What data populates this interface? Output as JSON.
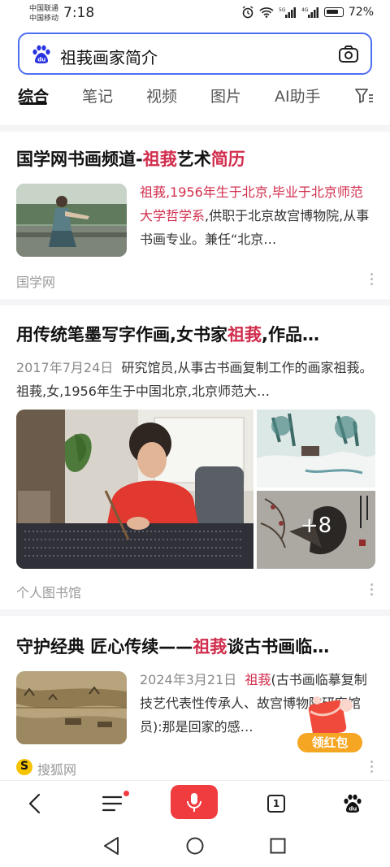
{
  "status": {
    "carrier1": "中国联通",
    "carrier2": "中国移动",
    "time": "7:18",
    "battery": "72%"
  },
  "search": {
    "query": "祖莪画家简介"
  },
  "tabs": [
    "综合",
    "笔记",
    "视频",
    "图片",
    "AI助手"
  ],
  "results": [
    {
      "title_pre": "国学网书画频道-",
      "title_hl": "祖莪",
      "title_mid": "艺术",
      "title_hl2": "简历",
      "snippet_hl": "祖莪,1956年生于北京,毕业于北京师范大学哲学系",
      "snippet_rest": ",供职于北京故宫博物院,从事书画专业。兼任“北京…",
      "source": "国学网"
    },
    {
      "title_pre": "用传统笔墨写字作画,女书家",
      "title_hl": "祖莪",
      "title_post": ",作品…",
      "date": "2017年7月24日",
      "snippet": "研究馆员,从事古书画复制工作的画家祖莪。 祖莪,女,1956年生于中国北京,北京师范大…",
      "more_images": "+8",
      "source": "个人图书馆"
    },
    {
      "title_pre": "守护经典 匠心传续——",
      "title_hl": "祖莪",
      "title_post": "谈古书画临…",
      "date": "2024年3月21日",
      "snippet_hl": "祖莪",
      "snippet_rest": "(古书画临摹复制技艺代表性传承人、故宫博物院研究馆员):那是回家的感…",
      "source": "搜狐网"
    }
  ],
  "floating": {
    "redpacket_label": "领红包"
  },
  "bottom_nav": {
    "tab_count": "1"
  },
  "colors": {
    "highlight": "#d12e4d",
    "accent": "#4e6ef2",
    "mic": "#f03b3f"
  }
}
